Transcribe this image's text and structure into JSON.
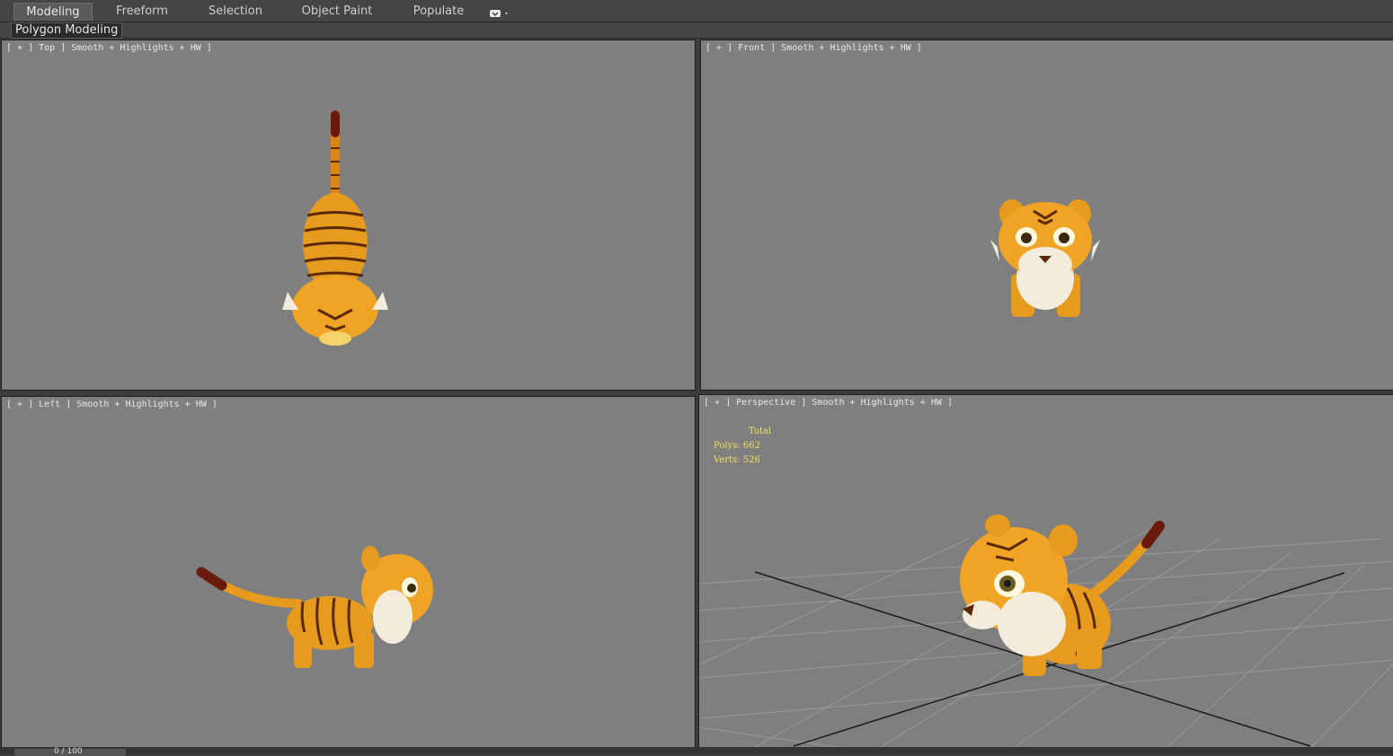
{
  "ribbon": {
    "tabs": [
      {
        "label": "Modeling",
        "active": true
      },
      {
        "label": "Freeform"
      },
      {
        "label": "Selection"
      },
      {
        "label": "Object Paint"
      },
      {
        "label": "Populate"
      }
    ],
    "panel_label": "Polygon Modeling"
  },
  "viewports": [
    {
      "label": "[ + ] Top ] Smooth + Highlights + HW ]"
    },
    {
      "label": "[ + ] Front ] Smooth + Highlights + HW ]"
    },
    {
      "label": "[ + ] Left ] Smooth + Highlights + HW ]"
    },
    {
      "label": "[ + ] Perspective ] Smooth + Highlights + HW ]"
    }
  ],
  "stats": {
    "title": "Total",
    "polys_label": "Polys:",
    "polys_value": "662",
    "verts_label": "Verts:",
    "verts_value": "526"
  },
  "status": {
    "frame": "0 / 100"
  },
  "colors": {
    "viewport_bg": "#7f7f7f",
    "stats_text": "#f0e060",
    "tiger_orange": "#e69a1e",
    "tiger_stripe": "#5a2a08",
    "tail_tip": "#6a1a0a"
  }
}
